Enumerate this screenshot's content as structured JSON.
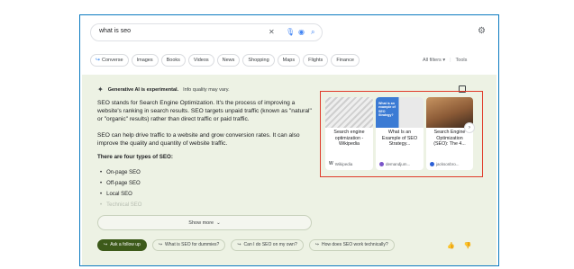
{
  "search": {
    "query": "what is seo"
  },
  "filters": {
    "chips": [
      {
        "label": "Converse",
        "icon": "converse-icon"
      },
      {
        "label": "Images"
      },
      {
        "label": "Books"
      },
      {
        "label": "Videos"
      },
      {
        "label": "News"
      },
      {
        "label": "Shopping"
      },
      {
        "label": "Maps"
      },
      {
        "label": "Flights"
      },
      {
        "label": "Finance"
      }
    ],
    "all_filters_label": "All filters",
    "tools_label": "Tools"
  },
  "ai_overview": {
    "header_bold": "Generative AI is experimental.",
    "header_sub": "Info quality may vary.",
    "para1": "SEO stands for Search Engine Optimization. It's the process of improving a website's ranking in search results. SEO targets unpaid traffic (known as \"natural\" or \"organic\" results) rather than direct traffic or paid traffic.",
    "para2": "SEO can help drive traffic to a website and grow conversion rates. It can also improve the quality and quantity of website traffic.",
    "types_heading": "There are four types of SEO:",
    "types": [
      "On-page SEO",
      "Off-page SEO",
      "Local SEO",
      "Technical SEO"
    ],
    "show_more_label": "Show more",
    "followups": [
      "Ask a follow up",
      "What is SEO for dummies?",
      "Can I do SEO on my own?",
      "How does SEO work technically?"
    ],
    "sources": [
      {
        "title": "Search engine optimization - Wikipedia",
        "site": "Wikipedia",
        "fav_color": "#ffffff"
      },
      {
        "title": "What Is an Example of SEO Strategy...",
        "site": "demandjum...",
        "fav_color": "#7a55c9",
        "thumb_text": "What is an example of SEO Strategy?"
      },
      {
        "title": "Search Engine Optimization (SEO): The 4...",
        "site": "jacksonbro...",
        "fav_color": "#2b5fd6"
      }
    ]
  }
}
